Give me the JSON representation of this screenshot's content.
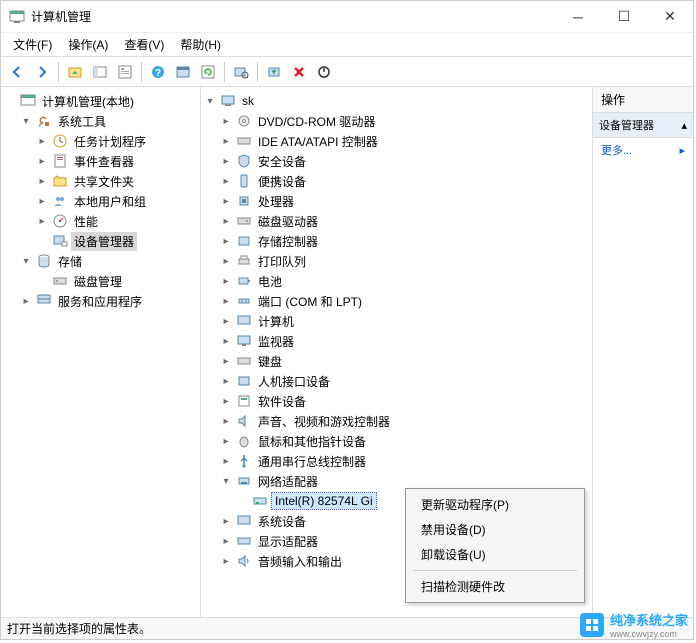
{
  "title": "计算机管理",
  "menus": {
    "file": "文件(F)",
    "action": "操作(A)",
    "view": "查看(V)",
    "help": "帮助(H)"
  },
  "left_tree": {
    "root": "计算机管理(本地)",
    "system_tools": "系统工具",
    "task_scheduler": "任务计划程序",
    "event_viewer": "事件查看器",
    "shared_folders": "共享文件夹",
    "local_users": "本地用户和组",
    "performance": "性能",
    "device_manager": "设备管理器",
    "storage": "存储",
    "disk_management": "磁盘管理",
    "services_apps": "服务和应用程序"
  },
  "devices": {
    "root": "sk",
    "dvd": "DVD/CD-ROM 驱动器",
    "ide": "IDE ATA/ATAPI 控制器",
    "security": "安全设备",
    "portable": "便携设备",
    "processors": "处理器",
    "disk_drives": "磁盘驱动器",
    "storage_ctrl": "存储控制器",
    "print_queue": "打印队列",
    "battery": "电池",
    "ports": "端口 (COM 和 LPT)",
    "computer": "计算机",
    "monitors": "监视器",
    "keyboard": "键盘",
    "hid": "人机接口设备",
    "software": "软件设备",
    "sound": "声音、视频和游戏控制器",
    "mice": "鼠标和其他指针设备",
    "usb": "通用串行总线控制器",
    "network": "网络适配器",
    "network_item": "Intel(R) 82574L Gi",
    "system_devices": "系统设备",
    "display": "显示适配器",
    "audio_io": "音频输入和输出"
  },
  "right": {
    "header": "操作",
    "selected": "设备管理器",
    "more": "更多..."
  },
  "context_menu": {
    "update": "更新驱动程序(P)",
    "disable": "禁用设备(D)",
    "uninstall": "卸载设备(U)",
    "scan": "扫描检测硬件改"
  },
  "status": "打开当前选择项的属性表。",
  "watermark": {
    "text": "纯净系统之家",
    "url": "www.cwvjzy.com"
  }
}
